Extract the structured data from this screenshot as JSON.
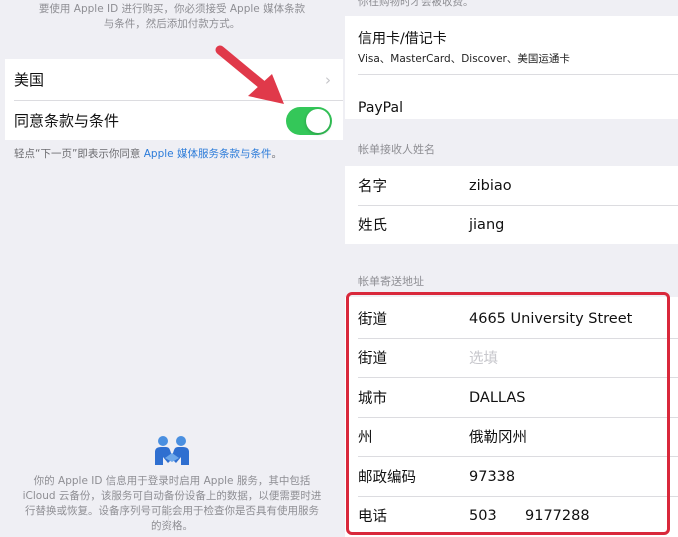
{
  "left": {
    "top_text_line1": "要使用 Apple ID 进行购买，你必须接受 Apple 媒体条款",
    "top_text_line2": "与条件，然后添加付款方式。",
    "country": "美国",
    "agree_label": "同意条款与条件",
    "agree_toggle_on": true,
    "note_prefix": "轻点“下一页”即表示你同意 ",
    "note_link": "Apple 媒体服务条款与条件",
    "note_suffix": "。",
    "bottom_text_line1": "你的 Apple ID 信息用于登录时启用 Apple 服务，其中包括",
    "bottom_text_line2": "iCloud 云备份，该服务可自动备份设备上的数据，以便需要时进",
    "bottom_text_line3": "行替换或恢复。设备序列号可能会用于检查你是否具有使用服务",
    "bottom_text_line4": "的资格。"
  },
  "right": {
    "top_cut_text": "你往购物时才会被收费。",
    "payment": {
      "card_title": "信用卡/借记卡",
      "card_sub": "Visa、MasterCard、Discover、美国运通卡",
      "paypal": "PayPal"
    },
    "recipient_header": "帐单接收人姓名",
    "first_name_label": "名字",
    "first_name_value": "zibiao",
    "last_name_label": "姓氏",
    "last_name_value": "jiang",
    "address_header": "帐单寄送地址",
    "street1_label": "街道",
    "street1_value": "4665 University Street",
    "street2_label": "街道",
    "street2_placeholder": "选填",
    "city_label": "城市",
    "city_value": "DALLAS",
    "state_label": "州",
    "state_value": "俄勒冈州",
    "zip_label": "邮政编码",
    "zip_value": "97338",
    "phone_label": "电话",
    "phone_area": "503",
    "phone_number": "9177288"
  },
  "colors": {
    "toggle_on": "#34c759",
    "arrow": "#e0394a",
    "highlight_border": "#d9283b",
    "link": "#2b7bd9"
  }
}
